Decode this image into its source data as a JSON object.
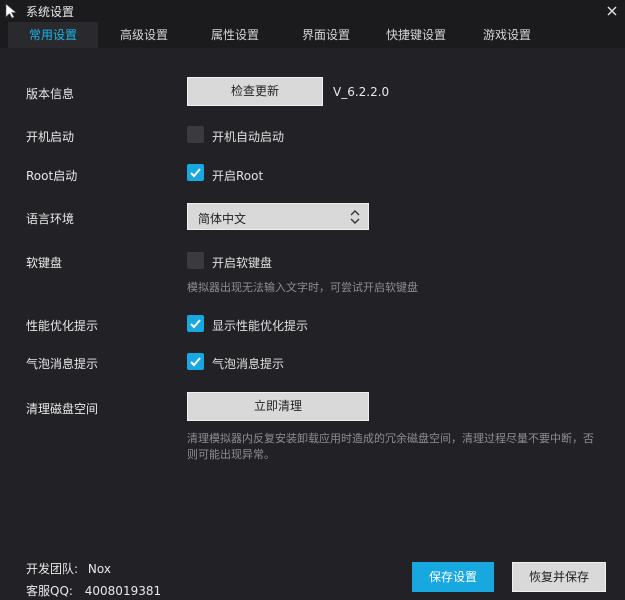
{
  "window": {
    "title": "系统设置",
    "close_icon": "close-icon",
    "logo_icon": "cursor-logo-icon"
  },
  "tabs": [
    {
      "label": "常用设置",
      "active": true
    },
    {
      "label": "高级设置",
      "active": false
    },
    {
      "label": "属性设置",
      "active": false
    },
    {
      "label": "界面设置",
      "active": false
    },
    {
      "label": "快捷键设置",
      "active": false
    },
    {
      "label": "游戏设置",
      "active": false
    }
  ],
  "version_info": {
    "label": "版本信息",
    "button": "检查更新",
    "version": "V_6.2.2.0"
  },
  "autostart": {
    "label": "开机启动",
    "option": "开机自动启动",
    "checked": false
  },
  "root": {
    "label": "Root启动",
    "option": "开启Root",
    "checked": true
  },
  "language": {
    "label": "语言环境",
    "value": "简体中文"
  },
  "soft_keyboard": {
    "label": "软键盘",
    "option": "开启软键盘",
    "checked": false,
    "hint": "模拟器出现无法输入文字时，可尝试开启软键盘"
  },
  "perf_hint": {
    "label": "性能优化提示",
    "option": "显示性能优化提示",
    "checked": true
  },
  "bubble": {
    "label": "气泡消息提示",
    "option": "气泡消息提示",
    "checked": true
  },
  "disk_clean": {
    "label": "清理磁盘空间",
    "button": "立即清理",
    "hint_line1": "清理模拟器内反复安装卸载应用时造成的冗余磁盘空间，清理过程尽量不要中断，否",
    "hint_line2": "则可能出现异常。"
  },
  "footer": {
    "team_label": "开发团队:",
    "team_value": "Nox",
    "qq_label": "客服QQ:",
    "qq_value": "4008019381",
    "save_button": "保存设置",
    "restore_button": "恢复并保存"
  },
  "colors": {
    "accent": "#17a8e0",
    "background": "#222226",
    "titlebar": "#1b1b1e"
  }
}
